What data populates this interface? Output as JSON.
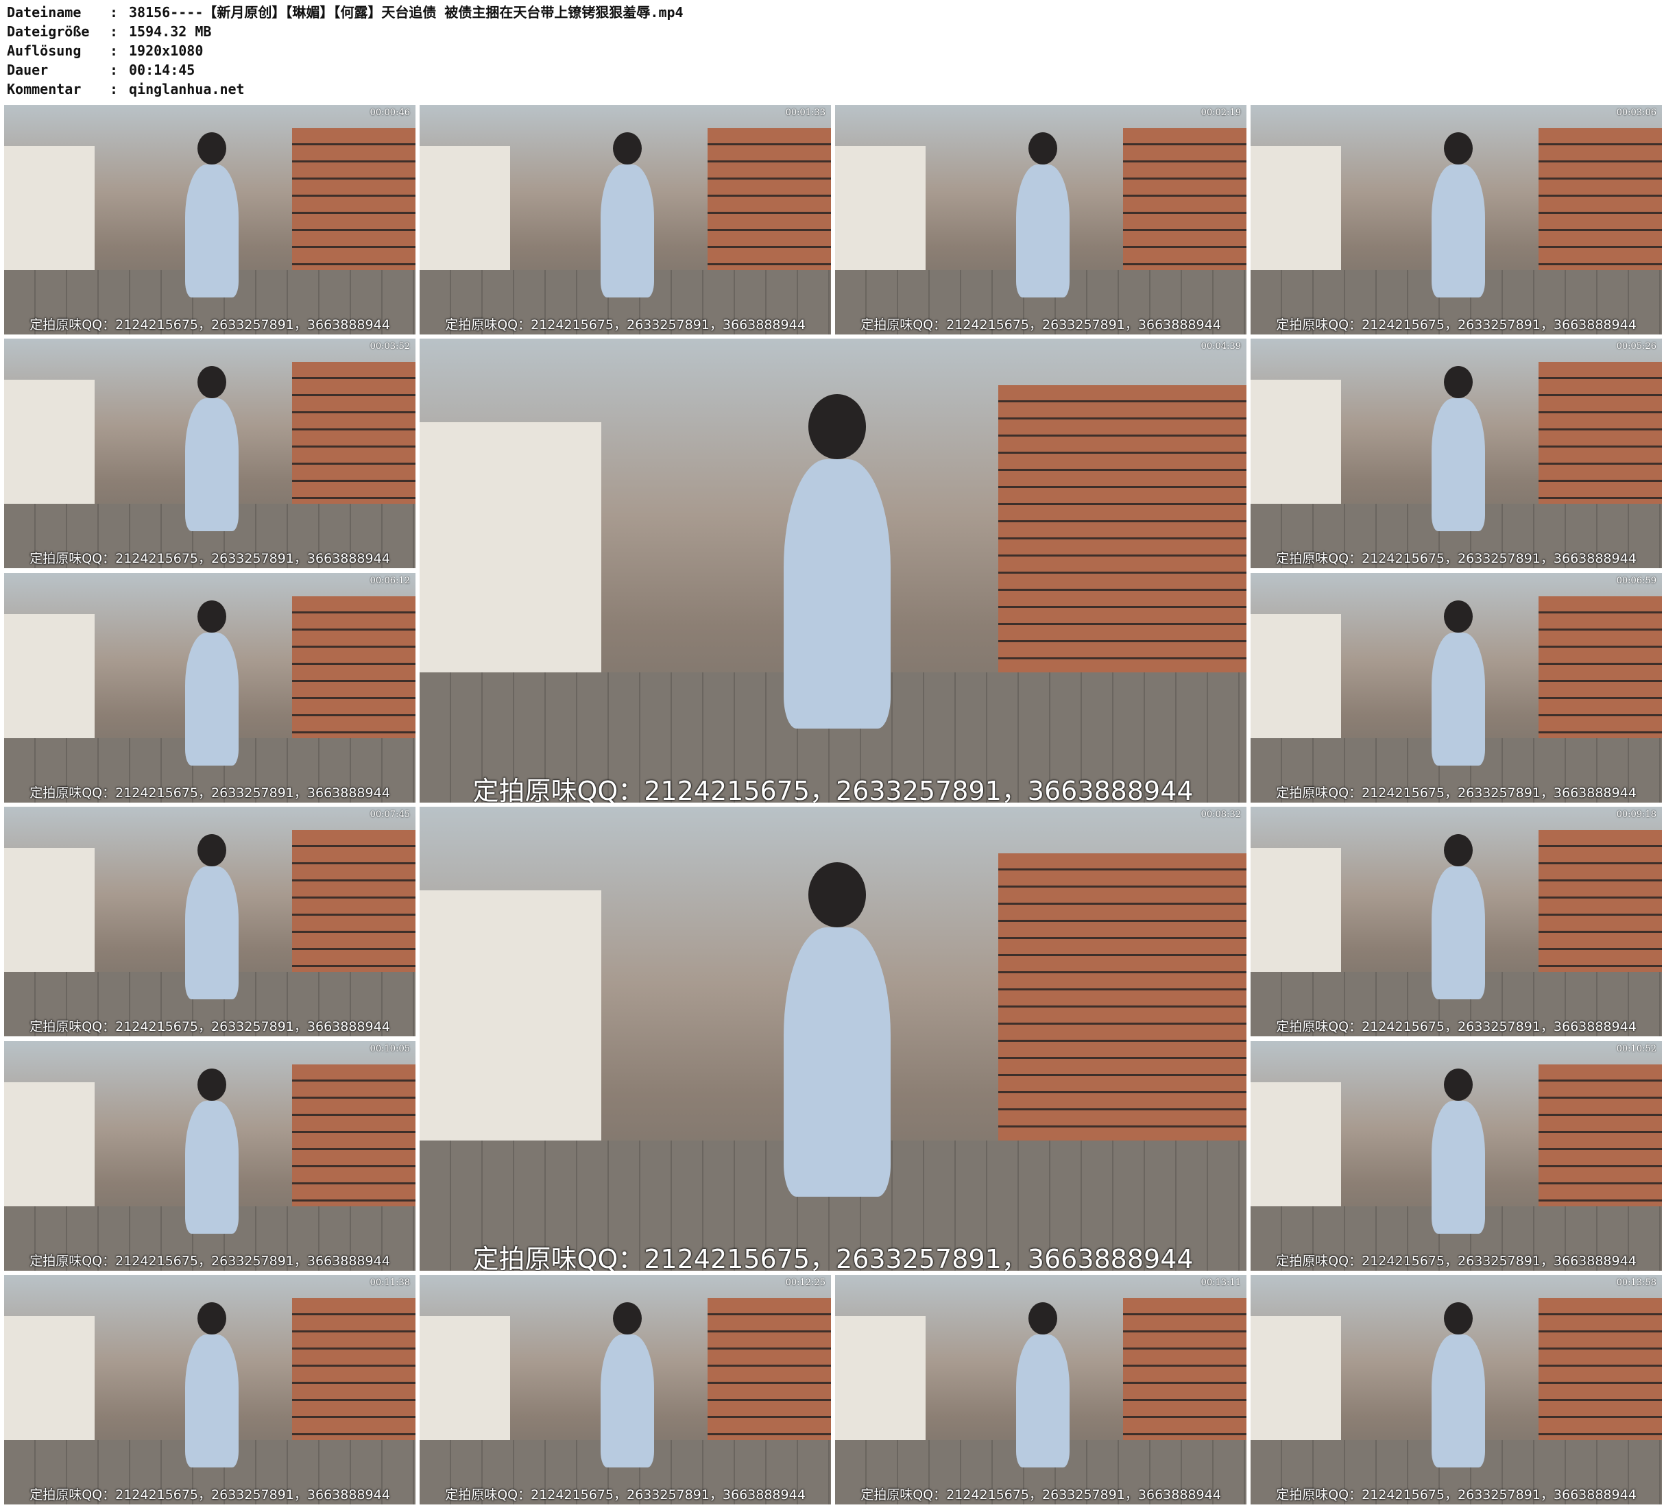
{
  "header": {
    "rows": [
      {
        "label": "Dateiname",
        "value": "38156----【新月原创】【琳媚】【何露】天台追债 被债主捆在天台带上镣铐狠狠羞辱.mp4"
      },
      {
        "label": "Dateigröße",
        "value": "1594.32 MB"
      },
      {
        "label": "Auflösung",
        "value": "1920x1080"
      },
      {
        "label": "Dauer",
        "value": "00:14:45"
      },
      {
        "label": "Kommentar",
        "value": "qinglanhua.net"
      }
    ]
  },
  "watermark": "定拍原味QQ：2124215675，2633257891，3663888944",
  "timestamps": [
    "00:00:46",
    "00:01:33",
    "00:02:19",
    "00:03:06",
    "00:03:52",
    "00:04:39",
    "00:05:26",
    "00:06:12",
    "00:06:59",
    "00:07:45",
    "00:08:32",
    "00:09:18",
    "00:10:05",
    "00:10:52",
    "00:11:38",
    "00:12:25",
    "00:13:11",
    "00:13:58"
  ]
}
